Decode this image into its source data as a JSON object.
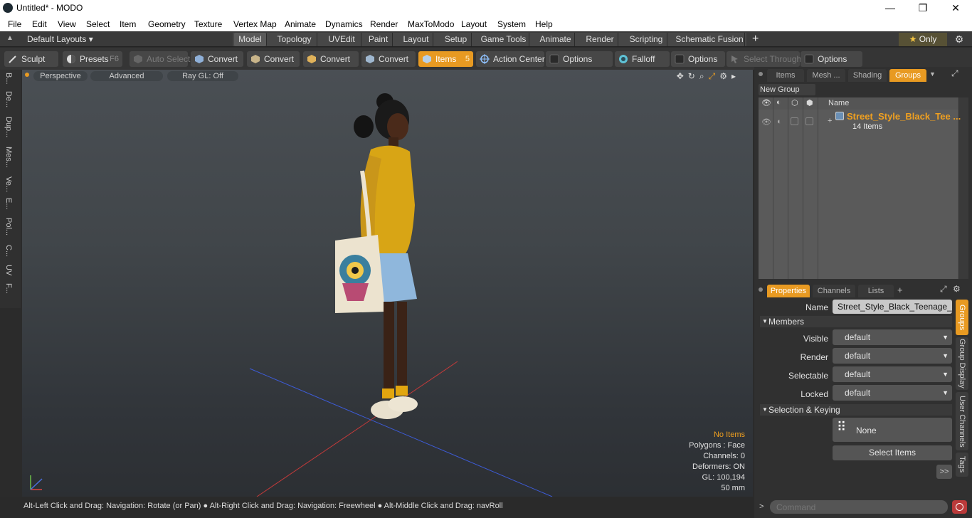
{
  "window": {
    "title": "Untitled* - MODO",
    "minimize": "—",
    "maximize": "❐",
    "close": "✕"
  },
  "menu": [
    "File",
    "Edit",
    "View",
    "Select",
    "Item",
    "Geometry",
    "Texture",
    "Vertex Map",
    "Animate",
    "Dynamics",
    "Render",
    "MaxToModo",
    "Layout",
    "System",
    "Help"
  ],
  "layouts": {
    "dropdown": "Default Layouts ▾",
    "tabs": [
      "Model",
      "Topology",
      "UVEdit",
      "Paint",
      "Layout",
      "Setup",
      "Game Tools",
      "Animate",
      "Render",
      "Scripting",
      "Schematic Fusion"
    ],
    "active": "Model",
    "only_label": "Only"
  },
  "toolbar": {
    "sculpt": "Sculpt",
    "presets": "Presets",
    "presets_key": "F6",
    "auto_select": "Auto Select",
    "convert": "Convert",
    "items": "Items",
    "items_key": "5",
    "action_center": "Action Center",
    "options": "Options",
    "falloff": "Falloff",
    "select_through": "Select Through"
  },
  "left_tabs": [
    "B...",
    "De...",
    "Dup...",
    "Mes...",
    "Ve...",
    "E...",
    "Pol...",
    "C...",
    "UV",
    "F..."
  ],
  "viewport": {
    "view_mode": "Perspective",
    "shading": "Advanced",
    "raygl": "Ray GL: Off",
    "info": {
      "items": "No Items",
      "polygons": "Polygons : Face",
      "channels": "Channels: 0",
      "deformers": "Deformers: ON",
      "gl": "GL: 100,194",
      "scale": "50 mm"
    }
  },
  "status_text": "Alt-Left Click and Drag: Navigation: Rotate (or Pan) ● Alt-Right Click and Drag: Navigation: Freewheel ● Alt-Middle Click and Drag: navRoll",
  "groups_panel": {
    "tabs": [
      "Items",
      "Mesh ...",
      "Shading",
      "Groups"
    ],
    "active_tab": "Groups",
    "new_group": "New Group",
    "col_name": "Name",
    "group_name": "Street_Style_Black_Tee ...",
    "group_count": "14 Items"
  },
  "properties": {
    "tabs": [
      "Properties",
      "Channels",
      "Lists"
    ],
    "add_tab": "+",
    "name_label": "Name",
    "name_value": "Street_Style_Black_Teenage_Gir",
    "members_section": "Members",
    "fields": [
      {
        "label": "Visible",
        "value": "default"
      },
      {
        "label": "Render",
        "value": "default"
      },
      {
        "label": "Selectable",
        "value": "default"
      },
      {
        "label": "Locked",
        "value": "default"
      }
    ],
    "selection_section": "Selection & Keying",
    "none_button": "None",
    "select_items_button": "Select Items",
    "more_button": ">>"
  },
  "right_vtabs": [
    "Groups",
    "Group Display",
    "User Channels",
    "Tags"
  ],
  "command": {
    "placeholder": "Command",
    "arrow": ">"
  }
}
